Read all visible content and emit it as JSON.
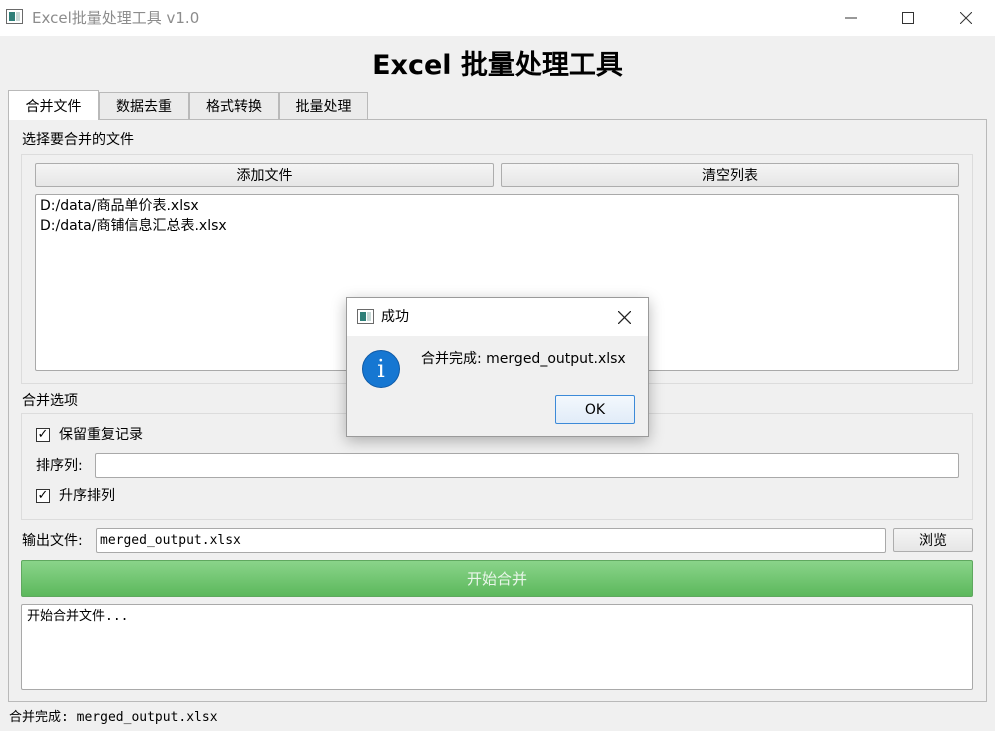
{
  "window": {
    "title": "Excel批量处理工具 v1.0",
    "minimize_icon": "minimize-icon",
    "maximize_icon": "maximize-icon",
    "close_icon": "close-icon"
  },
  "header": {
    "title": "Excel 批量处理工具"
  },
  "tabs": [
    {
      "label": "合并文件",
      "active": true
    },
    {
      "label": "数据去重",
      "active": false
    },
    {
      "label": "格式转换",
      "active": false
    },
    {
      "label": "批量处理",
      "active": false
    }
  ],
  "merge_tab": {
    "select_section_label": "选择要合并的文件",
    "add_files_label": "添加文件",
    "clear_list_label": "清空列表",
    "files": [
      "D:/data/商品单价表.xlsx",
      "D:/data/商铺信息汇总表.xlsx"
    ],
    "options_label": "合并选项",
    "keep_duplicates": {
      "label": "保留重复记录",
      "checked": true
    },
    "sort_column": {
      "label": "排序列:",
      "value": ""
    },
    "ascending": {
      "label": "升序排列",
      "checked": true
    },
    "output": {
      "label": "输出文件:",
      "value": "merged_output.xlsx"
    },
    "browse_label": "浏览",
    "start_label": "开始合并",
    "log_text": "开始合并文件..."
  },
  "status_bar": {
    "text": "合并完成: merged_output.xlsx"
  },
  "dialog": {
    "title": "成功",
    "message": "合并完成: merged_output.xlsx",
    "ok_label": "OK",
    "icon": "info-icon"
  },
  "colors": {
    "start_button": "#5cb85c",
    "info_icon": "#1677d2",
    "ok_border": "#3c8ad8"
  }
}
